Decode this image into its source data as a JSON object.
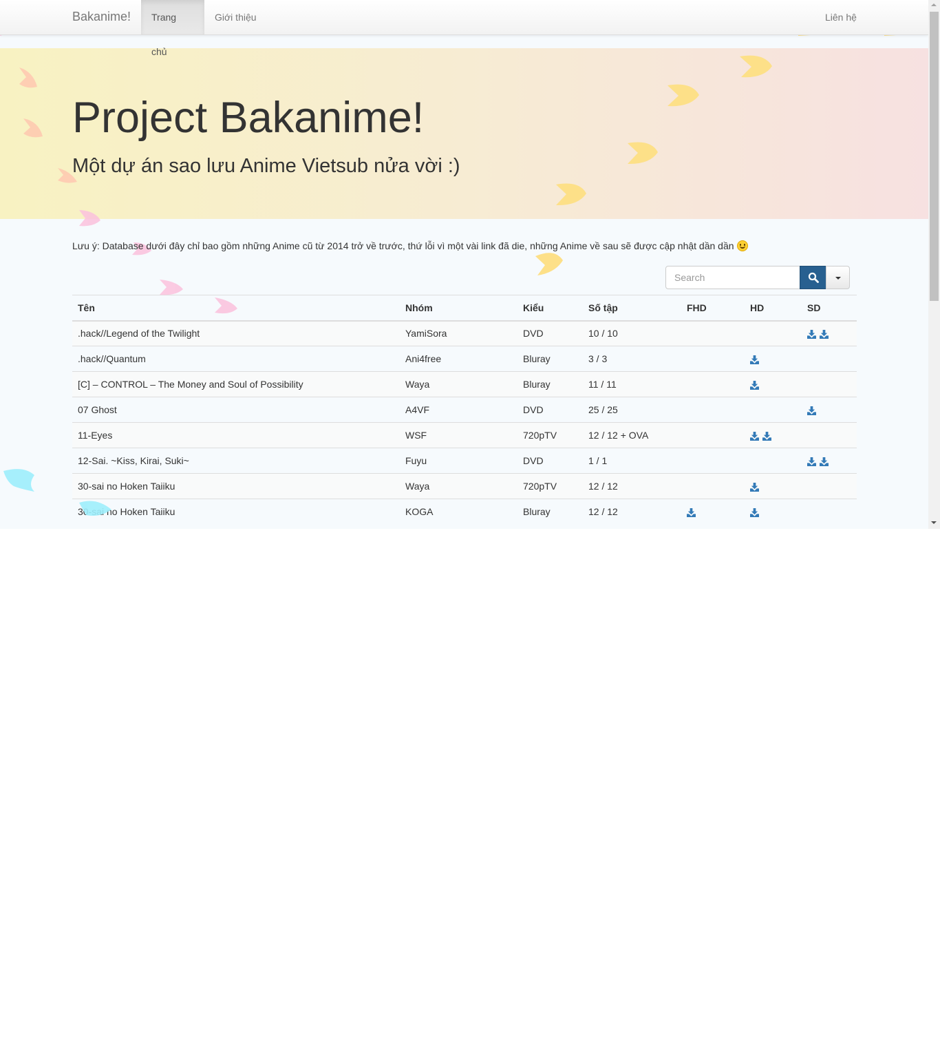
{
  "navbar": {
    "brand": "Bakanime!",
    "items": [
      {
        "label": "Trang chủ",
        "active": true
      },
      {
        "label": "Giới thiệu",
        "active": false
      }
    ],
    "right_item": "Liên hệ"
  },
  "hero": {
    "title": "Project Bakanime!",
    "subtitle": "Một dự án sao lưu Anime Vietsub nửa vời :)"
  },
  "note": "Lưu ý: Database dưới đây chỉ bao gồm những Anime cũ từ 2014 trở về trước, thứ lỗi vì một vài link đã die, những Anime về sau sẽ được cập nhật dần dần",
  "search": {
    "placeholder": "Search",
    "value": ""
  },
  "table": {
    "headers": [
      "Tên",
      "Nhóm",
      "Kiểu",
      "Số tập",
      "FHD",
      "HD",
      "SD"
    ],
    "rows": [
      {
        "name": ".hack//Legend of the Twilight",
        "group": "YamiSora",
        "type": "DVD",
        "episodes": "10 / 10",
        "fhd": 0,
        "hd": 0,
        "sd": 2
      },
      {
        "name": ".hack//Quantum",
        "group": "Ani4free",
        "type": "Bluray",
        "episodes": "3 / 3",
        "fhd": 0,
        "hd": 1,
        "sd": 0
      },
      {
        "name": "[C] – CONTROL – The Money and Soul of Possibility",
        "group": "Waya",
        "type": "Bluray",
        "episodes": "11 / 11",
        "fhd": 0,
        "hd": 1,
        "sd": 0
      },
      {
        "name": "07 Ghost",
        "group": "A4VF",
        "type": "DVD",
        "episodes": "25 / 25",
        "fhd": 0,
        "hd": 0,
        "sd": 1
      },
      {
        "name": "11-Eyes",
        "group": "WSF",
        "type": "720pTV",
        "episodes": "12 / 12 + OVA",
        "fhd": 0,
        "hd": 2,
        "sd": 0
      },
      {
        "name": "12-Sai. ~Kiss, Kirai, Suki~",
        "group": "Fuyu",
        "type": "DVD",
        "episodes": "1 / 1",
        "fhd": 0,
        "hd": 0,
        "sd": 2
      },
      {
        "name": "30-sai no Hoken Taiiku",
        "group": "Waya",
        "type": "720pTV",
        "episodes": "12 / 12",
        "fhd": 0,
        "hd": 1,
        "sd": 0
      },
      {
        "name": "30-sai no Hoken Taiiku",
        "group": "KOGA",
        "type": "Bluray",
        "episodes": "12 / 12",
        "fhd": 1,
        "hd": 1,
        "sd": 0
      }
    ]
  },
  "icons": {
    "search": "search-icon",
    "dropdown": "caret-down-icon",
    "download": "download-icon",
    "emoji": "smiley-icon",
    "decorations": "sakura-petal-icon"
  },
  "colors": {
    "primary": "#286090",
    "download_icon": "#337ab7",
    "hero_left": "#f8f2c2",
    "hero_right": "#f7e1e1",
    "page_bg": "#f6fafd"
  }
}
